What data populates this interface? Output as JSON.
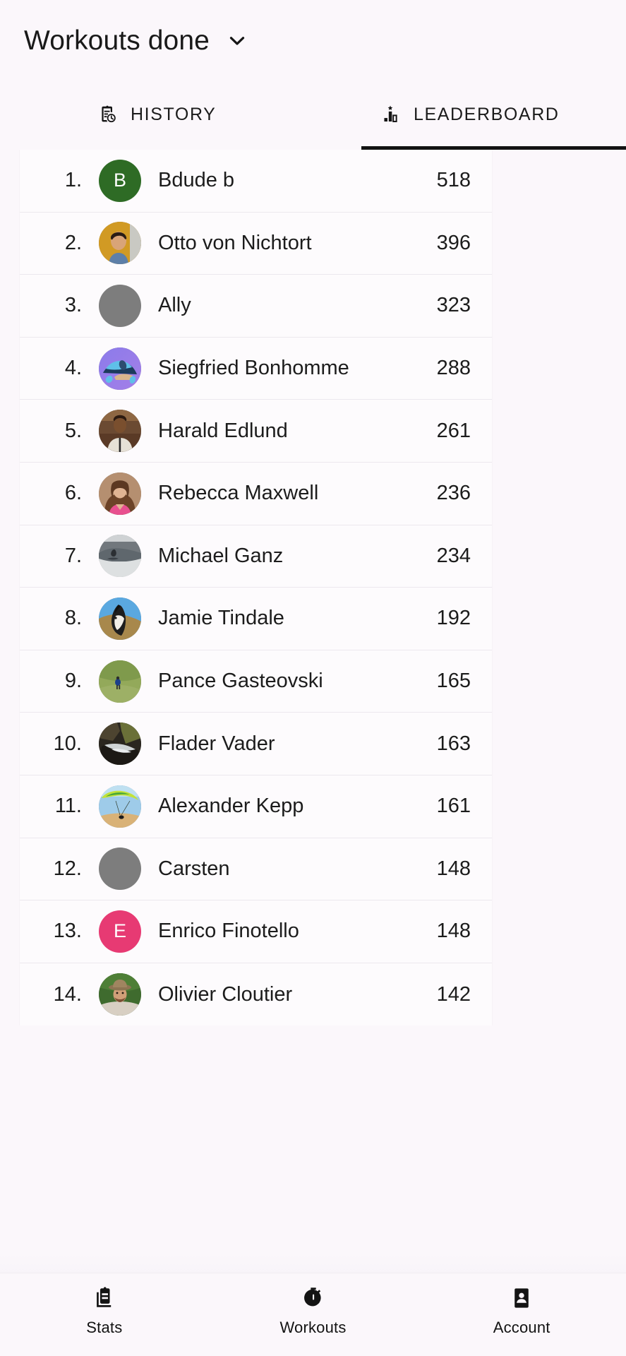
{
  "header": {
    "title": "Workouts done",
    "dropdown_icon": "chevron-down-icon"
  },
  "tabs": [
    {
      "label": "HISTORY",
      "icon": "history-clipboard-icon",
      "active": false
    },
    {
      "label": "LEADERBOARD",
      "icon": "podium-star-icon",
      "active": true
    }
  ],
  "leaderboard": {
    "rows": [
      {
        "rank": "1.",
        "name": "Bdude b",
        "score": "518",
        "avatar": {
          "type": "initial",
          "initial": "B",
          "color": "#2e6b25"
        }
      },
      {
        "rank": "2.",
        "name": "Otto von Nichtort",
        "score": "396",
        "avatar": {
          "type": "photo",
          "photo": "portrait-gold-background"
        }
      },
      {
        "rank": "3.",
        "name": "Ally",
        "score": "323",
        "avatar": {
          "type": "placeholder",
          "color": "#7d7d7d"
        }
      },
      {
        "rank": "4.",
        "name": "Siegfried Bonhomme",
        "score": "288",
        "avatar": {
          "type": "illustration",
          "photo": "blue-frog-purple-background"
        }
      },
      {
        "rank": "5.",
        "name": "Harald Edlund",
        "score": "261",
        "avatar": {
          "type": "photo",
          "photo": "man-white-jacket-indoors"
        }
      },
      {
        "rank": "6.",
        "name": "Rebecca Maxwell",
        "score": "236",
        "avatar": {
          "type": "photo",
          "photo": "woman-brown-hair-pink-top"
        }
      },
      {
        "rank": "7.",
        "name": "Michael Ganz",
        "score": "234",
        "avatar": {
          "type": "photo",
          "photo": "surfer-on-wave-grey"
        }
      },
      {
        "rank": "8.",
        "name": "Jamie Tindale",
        "score": "192",
        "avatar": {
          "type": "photo",
          "photo": "border-collie-dog-blue-sky"
        }
      },
      {
        "rank": "9.",
        "name": "Pance Gasteovski",
        "score": "165",
        "avatar": {
          "type": "photo",
          "photo": "hiker-on-green-hillside"
        }
      },
      {
        "rank": "10.",
        "name": "Flader Vader",
        "score": "163",
        "avatar": {
          "type": "photo",
          "photo": "dark-forest-stream"
        }
      },
      {
        "rank": "11.",
        "name": "Alexander Kepp",
        "score": "161",
        "avatar": {
          "type": "photo",
          "photo": "paraglider-green-canopy-sky"
        }
      },
      {
        "rank": "12.",
        "name": "Carsten",
        "score": "148",
        "avatar": {
          "type": "placeholder",
          "color": "#7d7d7d"
        }
      },
      {
        "rank": "13.",
        "name": "Enrico Finotello",
        "score": "148",
        "avatar": {
          "type": "initial",
          "initial": "E",
          "color": "#e73a73"
        }
      },
      {
        "rank": "14.",
        "name": "Olivier Cloutier",
        "score": "142",
        "avatar": {
          "type": "photo",
          "photo": "man-with-hat-in-greenery"
        }
      }
    ]
  },
  "bottom_nav": [
    {
      "label": "Stats",
      "icon": "clipboard-stats-icon"
    },
    {
      "label": "Workouts",
      "icon": "stopwatch-icon"
    },
    {
      "label": "Account",
      "icon": "contact-card-icon"
    }
  ]
}
